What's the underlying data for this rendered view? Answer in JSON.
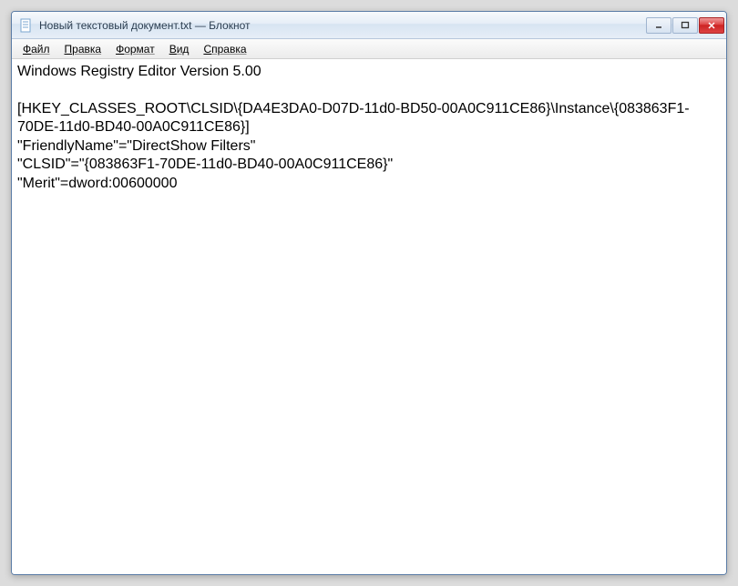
{
  "window": {
    "title": "Новый текстовый документ.txt — Блокнот"
  },
  "menubar": {
    "items": [
      {
        "label": "Файл"
      },
      {
        "label": "Правка"
      },
      {
        "label": "Формат"
      },
      {
        "label": "Вид"
      },
      {
        "label": "Справка"
      }
    ]
  },
  "document": {
    "lines": [
      "Windows Registry Editor Version 5.00",
      "",
      "[HKEY_CLASSES_ROOT\\CLSID\\{DA4E3DA0-D07D-11d0-BD50-00A0C911CE86}\\Instance\\{083863F1-70DE-11d0-BD40-00A0C911CE86}]",
      "\"FriendlyName\"=\"DirectShow Filters\"",
      "\"CLSID\"=\"{083863F1-70DE-11d0-BD40-00A0C911CE86}\"",
      "\"Merit\"=dword:00600000"
    ]
  }
}
